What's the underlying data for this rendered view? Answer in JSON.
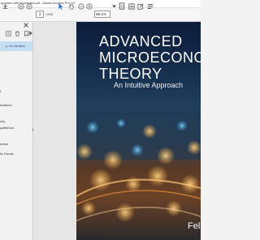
{
  "window": {
    "title": "pproach with Examples.pdf - Adobe Acrobat Pro DC"
  },
  "toolbar": {
    "page_number": "1",
    "page_count": "/ 895",
    "zoom": "98.1%",
    "icons": [
      "save-icon",
      "page-up-icon",
      "page-down-icon",
      "select-cursor-icon",
      "hand-icon",
      "zoom-out-icon",
      "zoom-in-icon",
      "zoom-dropdown-icon",
      "fit-page-icon",
      "read-mode-icon",
      "edit-icon",
      "comment-icon"
    ]
  },
  "sidebar": {
    "bookmarks": [
      {
        "label": "y: An Intuitive",
        "selected": true
      },
      {
        "label": "t",
        "selected": false
      },
      {
        "label": "lications",
        "selected": false
      },
      {
        "label": "nity",
        "selected": false
      },
      {
        "label": "quilibrium",
        "selected": false
      },
      {
        "label": "",
        "selected": false
      },
      {
        "label": "erfect",
        "selected": false
      },
      {
        "label": "lic Goods",
        "selected": false
      }
    ]
  },
  "document": {
    "title_line1": "ADVANCED",
    "title_line2": "MICROECONO",
    "title_line3": "THEORY",
    "subtitle": "An Intuitive Approach",
    "author": "Felix"
  }
}
